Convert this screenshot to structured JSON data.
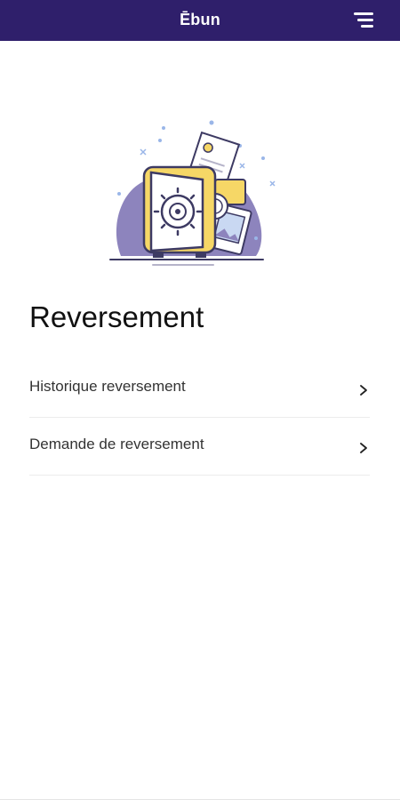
{
  "header": {
    "title": "Ēbun",
    "menu_icon": "hamburger-menu-icon",
    "background_color": "#2f1f6b"
  },
  "illustration": {
    "icon": "safe-vault-illustration",
    "accent_color": "#f6d766",
    "blob_color": "#8d84bd"
  },
  "page": {
    "title": "Reversement"
  },
  "menu": {
    "items": [
      {
        "label": "Historique reversement",
        "icon": "chevron-right-icon"
      },
      {
        "label": "Demande de reversement",
        "icon": "chevron-right-icon"
      }
    ]
  }
}
